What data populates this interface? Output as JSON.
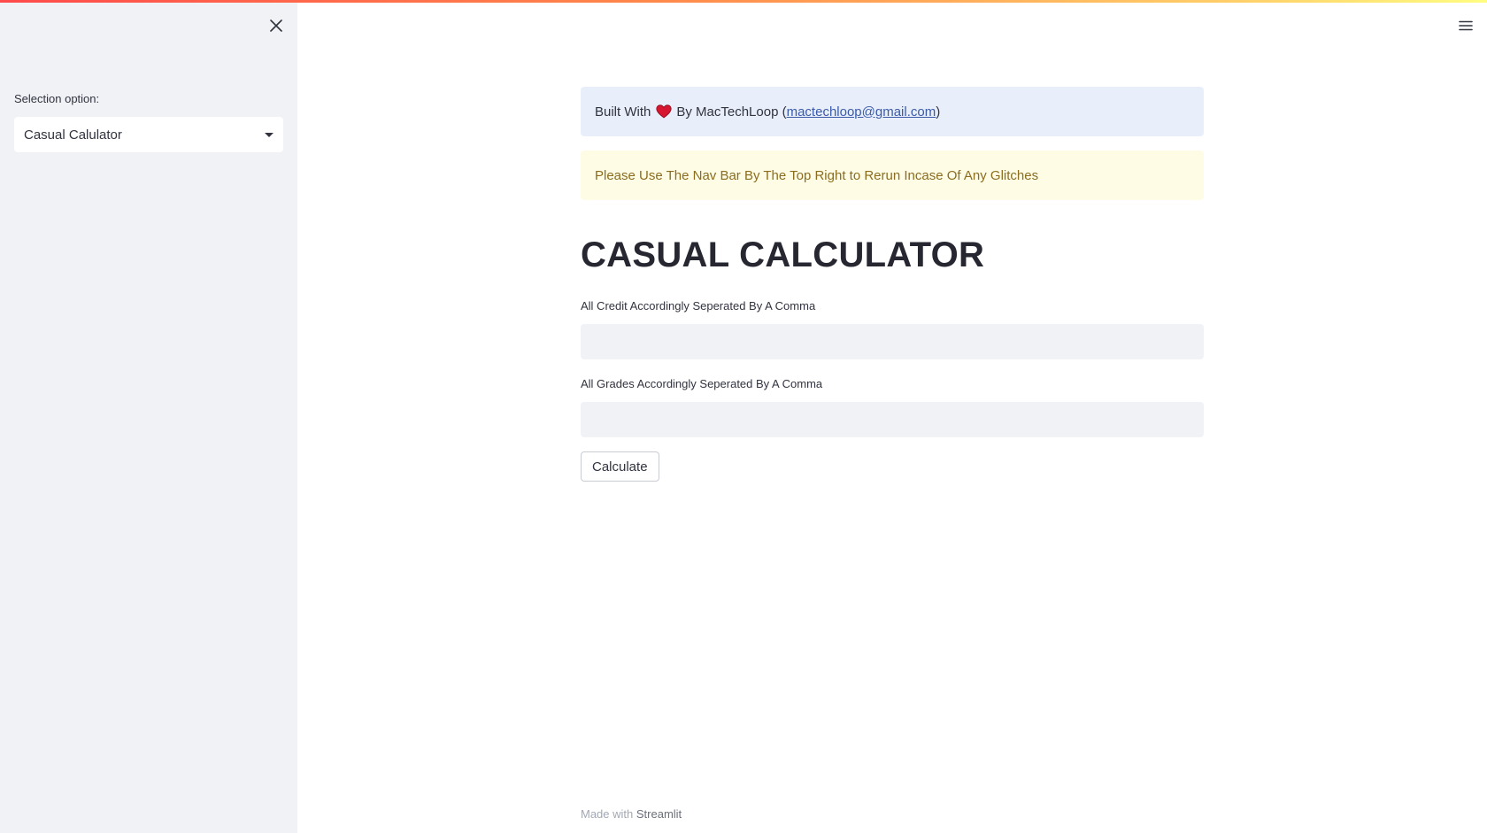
{
  "sidebar": {
    "label": "Selection option:",
    "select": {
      "value": "Casual Calulator"
    }
  },
  "banner": {
    "info_prefix": "Built With",
    "info_suffix": "By MacTechLoop (",
    "email": "mactechloop@gmail.com",
    "info_close": ")",
    "warning": "Please Use The Nav Bar By The Top Right to Rerun Incase Of Any Glitches"
  },
  "main": {
    "title": "CASUAL CALCULATOR",
    "credit_label": "All Credit Accordingly Seperated By A Comma",
    "credit_value": "",
    "grades_label": "All Grades Accordingly Seperated By A Comma",
    "grades_value": "",
    "calculate_label": "Calculate"
  },
  "footer": {
    "prefix": "Made with ",
    "brand": "Streamlit"
  },
  "colors": {
    "heart": "#d7162f",
    "sidebar_bg": "#f0f2f6",
    "info_bg": "#e8effb",
    "warning_bg": "#fffce6"
  },
  "icons": {
    "close": "close-icon",
    "menu": "hamburger-menu-icon",
    "caret": "chevron-down-icon",
    "heart": "heart-icon"
  }
}
